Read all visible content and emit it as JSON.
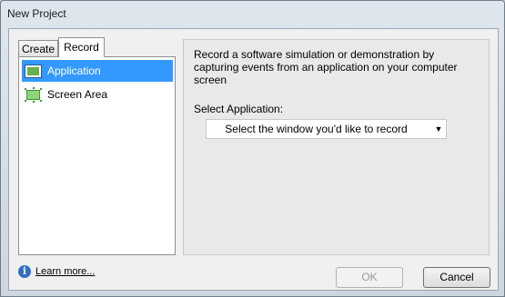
{
  "window": {
    "title": "New Project"
  },
  "tabs": [
    {
      "label": "Create",
      "active": false
    },
    {
      "label": "Record",
      "active": true
    }
  ],
  "list": {
    "items": [
      {
        "label": "Application",
        "icon": "application-window-icon",
        "selected": true
      },
      {
        "label": "Screen Area",
        "icon": "screen-area-icon",
        "selected": false
      }
    ]
  },
  "detail": {
    "description": "Record a software simulation or demonstration by capturing events from an application on your computer screen",
    "select_label": "Select Application:",
    "dropdown_value": "Select the window you'd like to record"
  },
  "footer": {
    "learn_more": "Learn more...",
    "ok_label": "OK",
    "cancel_label": "Cancel"
  },
  "colors": {
    "selection": "#3399ff",
    "info_icon": "#2f6fc4"
  }
}
